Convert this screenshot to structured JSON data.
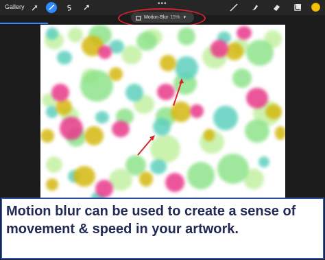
{
  "topbar": {
    "gallery_label": "Gallery",
    "more_dots": "•••",
    "tools_left": [
      "wrench-icon",
      "magic-wand-icon",
      "selection-icon",
      "transform-icon"
    ],
    "tools_right": [
      "brush-icon",
      "smudge-icon",
      "eraser-icon",
      "layers-icon"
    ],
    "color_swatch": "#f4c20d"
  },
  "adjustment": {
    "label": "Motion Blur",
    "percent": "15%",
    "icon": "adjustments-icon"
  },
  "colors": {
    "pink": "#e8398a",
    "teal": "#5dd0be",
    "green": "#8ee38b",
    "light_green": "#c4f0a3",
    "yellow": "#d4b80f",
    "arrow_red": "#d8242c",
    "caption_border": "#2f4fa0",
    "caption_text": "#222a55"
  },
  "caption": {
    "text": "Motion blur can be used to create a sense of movement & speed in your artwork."
  }
}
